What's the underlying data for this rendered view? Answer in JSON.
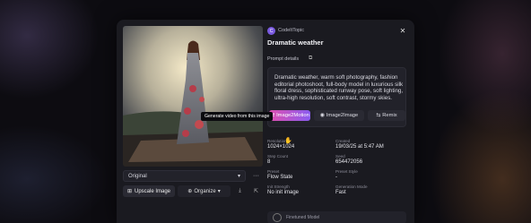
{
  "author": {
    "name": "CodeItTopic",
    "initial": "C"
  },
  "title": "Dramatic weather",
  "close_label": "✕",
  "prompt": {
    "label": "Prompt details",
    "text": "Dramatic weather, warm soft photography, fashion editorial photoshoot, full-body model in luxurious silk floral dress, sophisticated runway pose, soft lighting, ultra-high resolution, soft contrast, stormy skies."
  },
  "tooltip": "Generate video from this image",
  "tools": [
    {
      "label": "Image2Motion",
      "icon": "⇄"
    },
    {
      "label": "Image2Image",
      "icon": "◉"
    },
    {
      "label": "Remix",
      "icon": "⇆"
    }
  ],
  "meta": [
    {
      "key": "Resolution",
      "value": "1024×1024"
    },
    {
      "key": "Created",
      "value": "19/03/25 at 5:47 AM"
    },
    {
      "key": "Step Count",
      "value": "8"
    },
    {
      "key": "Seed",
      "value": "654472056"
    },
    {
      "key": "Preset",
      "value": "Flow State"
    },
    {
      "key": "Preset Style",
      "value": "-"
    },
    {
      "key": "Init Strength",
      "value": "No init image"
    },
    {
      "key": "Generation Mode",
      "value": "Fast"
    }
  ],
  "finetuned_label": "Finetuned Model",
  "version_select": {
    "value": "Original",
    "caret": "▾"
  },
  "more_label": "···",
  "upscale": {
    "label": "Upscale Image",
    "icon": "⊞"
  },
  "organize": {
    "label": "Organize",
    "icon": "⊕",
    "caret": "▾"
  },
  "download_icon": "⤓",
  "share_icon": "⇱",
  "copy_icon": "⧉",
  "cursor_icon": "✋",
  "colors": {
    "accent_start": "#e04fb0",
    "accent_end": "#8a5cf0",
    "panel": "#1a1a20"
  }
}
